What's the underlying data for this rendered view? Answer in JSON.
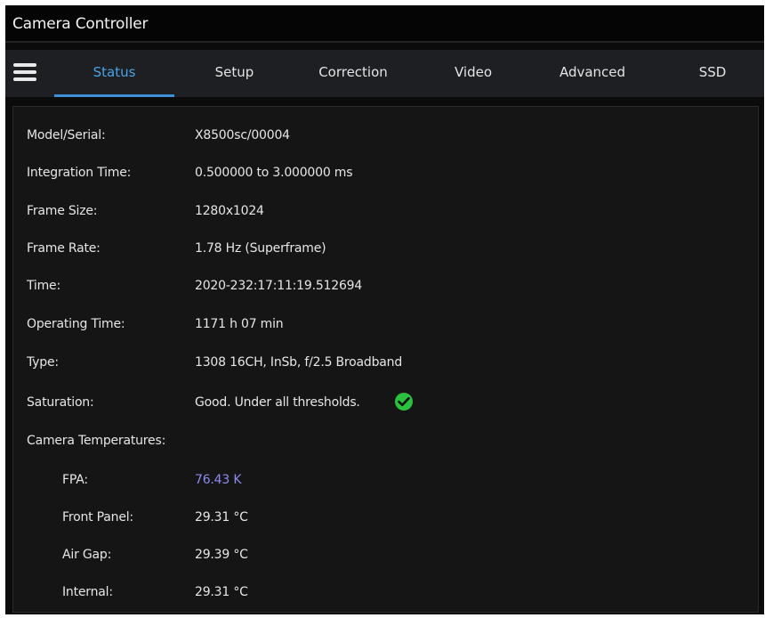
{
  "window": {
    "title": "Camera Controller"
  },
  "nav": {
    "menu_icon": "hamburger-menu-icon",
    "tabs": [
      {
        "label": "Status",
        "active": true
      },
      {
        "label": "Setup"
      },
      {
        "label": "Correction"
      },
      {
        "label": "Video"
      },
      {
        "label": "Advanced"
      },
      {
        "label": "SSD"
      }
    ],
    "active_color": "#4ba3e6"
  },
  "status": {
    "rows": [
      {
        "label": "Model/Serial:",
        "value": "X8500sc/00004"
      },
      {
        "label": "Integration Time:",
        "value": "0.500000 to 3.000000 ms"
      },
      {
        "label": "Frame Size:",
        "value": "1280x1024"
      },
      {
        "label": "Frame Rate:",
        "value": "1.78 Hz (Superframe)"
      },
      {
        "label": "Time:",
        "value": "2020-232:17:11:19.512694"
      },
      {
        "label": "Operating Time:",
        "value": "1171 h 07 min"
      },
      {
        "label": "Type:",
        "value": "1308 16CH, InSb, f/2.5 Broadband"
      },
      {
        "label": "Saturation:",
        "value": "Good. Under all thresholds.",
        "icon": "check-circle-icon",
        "icon_color": "#29c13d"
      }
    ],
    "temperatures_heading": "Camera Temperatures:",
    "temperatures": [
      {
        "label": "FPA:",
        "value": "76.43 K",
        "color": "#8c8cf0"
      },
      {
        "label": "Front Panel:",
        "value": "29.31 °C"
      },
      {
        "label": "Air Gap:",
        "value": "29.39 °C"
      },
      {
        "label": "Internal:",
        "value": "29.31 °C"
      }
    ]
  }
}
